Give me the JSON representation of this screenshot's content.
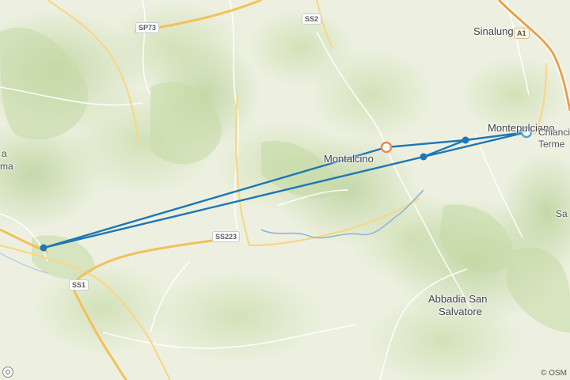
{
  "places": {
    "sinalunga": "Sinalunga",
    "montepulciano": "Montepulciano",
    "chianciano_1": "Chiancia",
    "chianciano_2": "Terme",
    "montalcino": "Montalcino",
    "abbadia_1": "Abbadia San",
    "abbadia_2": "Salvatore",
    "left_1": "a",
    "left_2": "ma",
    "right_partial": "Sa"
  },
  "roads": {
    "sp73": "SP73",
    "ss2": "SS2",
    "a1": "A1",
    "ss223": "SS223",
    "ss1": "SS1"
  },
  "route": {
    "start_marker": "route-start",
    "end_marker": "route-end"
  },
  "attribution": "© OSM",
  "colors": {
    "route": "#1f77b4",
    "start_marker": "#5a9fd4",
    "end_marker": "#f08a4b",
    "motorway": "#e8a04a",
    "road": "#f4d58a",
    "river": "#8fb6d9"
  }
}
